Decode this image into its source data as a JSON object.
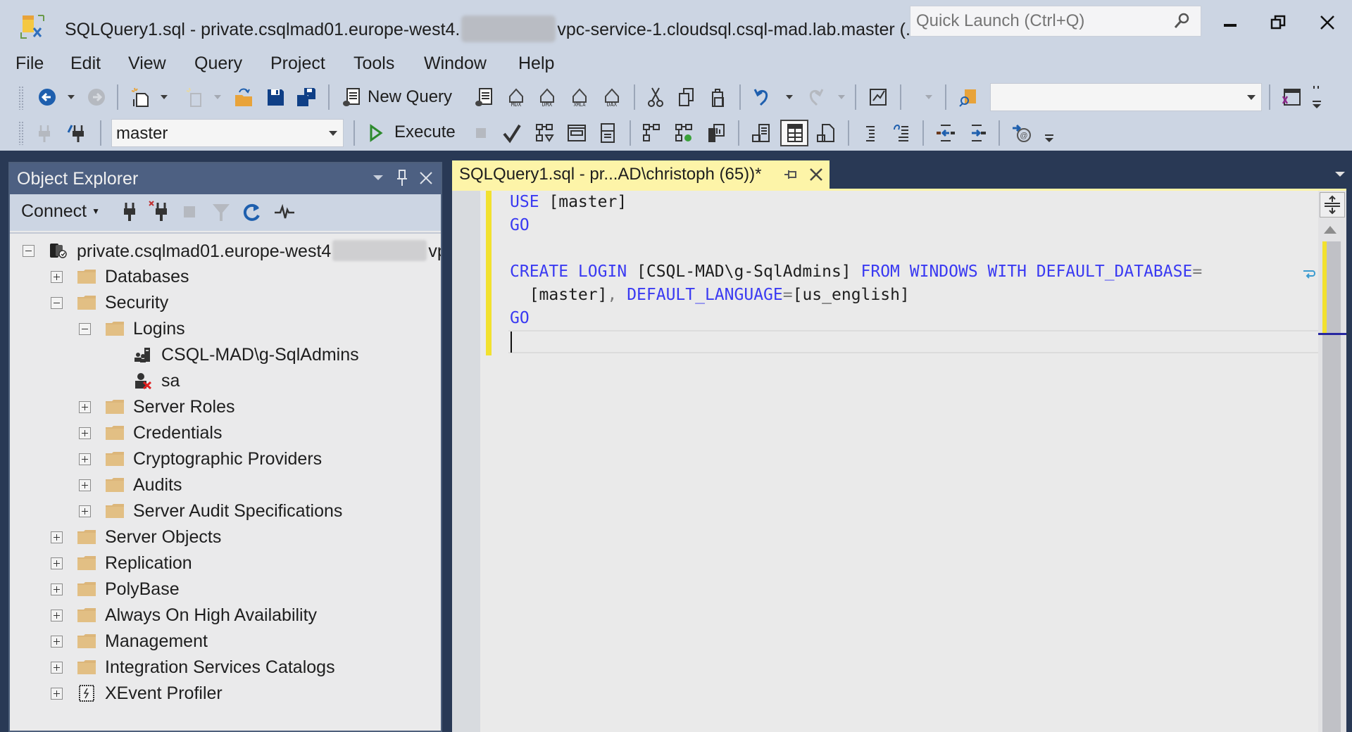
{
  "window": {
    "title_prefix": "SQLQuery1.sql - private.csqlmad01.europe-west4.",
    "title_suffix": "vpc-service-1.cloudsql.csql-mad.lab.master (...",
    "quick_launch_placeholder": "Quick Launch (Ctrl+Q)",
    "controls": [
      "minimize",
      "restore",
      "close"
    ]
  },
  "menu": [
    "File",
    "Edit",
    "View",
    "Query",
    "Project",
    "Tools",
    "Window",
    "Help"
  ],
  "toolbar1": {
    "new_query_label": "New Query",
    "solution_config_value": ""
  },
  "toolbar2": {
    "database_value": "master",
    "execute_label": "Execute"
  },
  "object_explorer": {
    "title": "Object Explorer",
    "connect_label": "Connect",
    "server_prefix": "private.csqlmad01.europe-west4",
    "server_suffix": "vp",
    "nodes": [
      {
        "label": "Databases",
        "state": "collapsed",
        "icon": "folder"
      },
      {
        "label": "Security",
        "state": "expanded",
        "icon": "folder"
      },
      {
        "label": "Logins",
        "state": "expanded",
        "icon": "folder"
      },
      {
        "label": "CSQL-MAD\\g-SqlAdmins",
        "state": "leaf",
        "icon": "windows-group-login"
      },
      {
        "label": "sa",
        "state": "leaf",
        "icon": "disabled-login"
      },
      {
        "label": "Server Roles",
        "state": "collapsed",
        "icon": "folder"
      },
      {
        "label": "Credentials",
        "state": "collapsed",
        "icon": "folder"
      },
      {
        "label": "Cryptographic Providers",
        "state": "collapsed",
        "icon": "folder"
      },
      {
        "label": "Audits",
        "state": "collapsed",
        "icon": "folder"
      },
      {
        "label": "Server Audit Specifications",
        "state": "collapsed",
        "icon": "folder"
      },
      {
        "label": "Server Objects",
        "state": "collapsed",
        "icon": "folder"
      },
      {
        "label": "Replication",
        "state": "collapsed",
        "icon": "folder"
      },
      {
        "label": "PolyBase",
        "state": "collapsed",
        "icon": "folder"
      },
      {
        "label": "Always On High Availability",
        "state": "collapsed",
        "icon": "folder"
      },
      {
        "label": "Management",
        "state": "collapsed",
        "icon": "folder"
      },
      {
        "label": "Integration Services Catalogs",
        "state": "collapsed",
        "icon": "folder"
      },
      {
        "label": "XEvent Profiler",
        "state": "collapsed",
        "icon": "xevent"
      }
    ]
  },
  "editor": {
    "tab_label": "SQLQuery1.sql - pr...AD\\christoph (65))*",
    "code": {
      "l1_kw": "USE",
      "l1_rest": " [master]",
      "l2_kw": "GO",
      "l4_kw1": "CREATE LOGIN",
      "l4_txt": " [CSQL-MAD\\g-SqlAdmins] ",
      "l4_kw2": "FROM WINDOWS WITH DEFAULT_DATABASE",
      "l4_op": "=",
      "l5_txt1": "  [master]",
      "l5_op1": ", ",
      "l5_kw": "DEFAULT_LANGUAGE",
      "l5_op2": "=",
      "l5_txt2": "[us_english]",
      "l6_kw": "GO"
    }
  },
  "colors": {
    "chrome": "#ccd5e3",
    "background_dark": "#293955",
    "tab_active": "#fdf4a8",
    "keyword": "#3a3af2",
    "change_marker": "#f2e12f"
  }
}
